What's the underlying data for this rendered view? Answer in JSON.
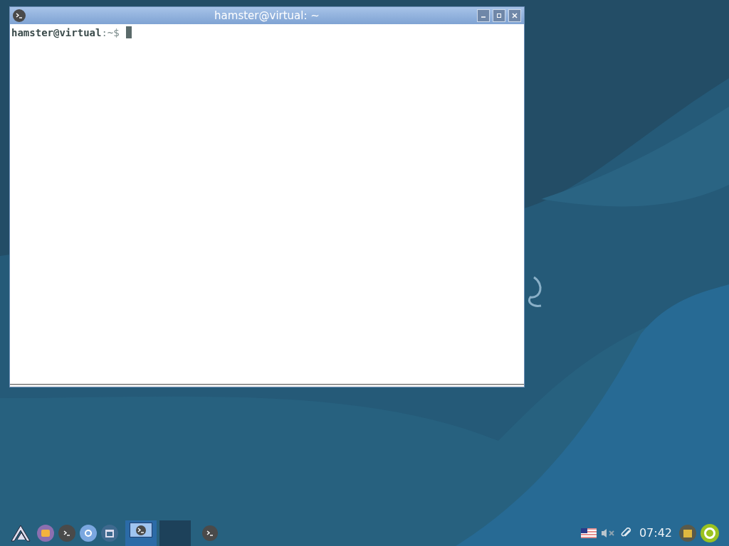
{
  "window": {
    "title": "hamster@virtual: ~",
    "prompt_host": "hamster@virtual",
    "prompt_path": ":~$"
  },
  "taskbar": {
    "launchers": [
      {
        "kind": "menu"
      },
      {
        "kind": "files"
      },
      {
        "kind": "terminal"
      },
      {
        "kind": "browser"
      },
      {
        "kind": "desktop"
      }
    ],
    "workspaces": [
      {
        "selected": true,
        "has_window": true
      },
      {
        "selected": false,
        "has_window": false
      }
    ],
    "tasks": [
      {
        "kind": "terminal"
      }
    ],
    "tray": {
      "muted": true,
      "clock": "07:42"
    }
  }
}
